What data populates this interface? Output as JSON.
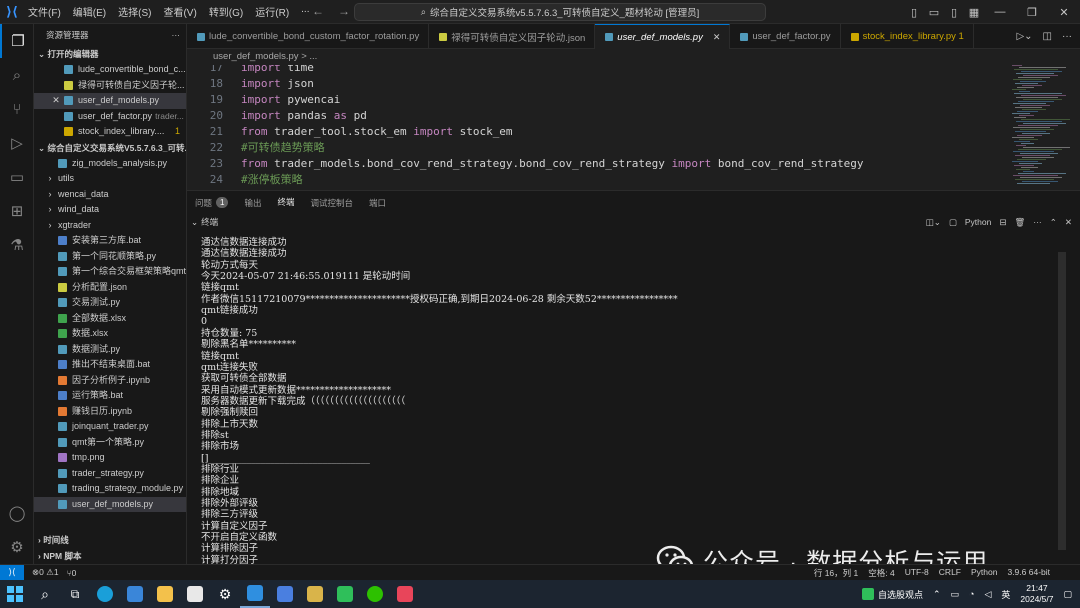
{
  "titlebar": {
    "menu": [
      "文件(F)",
      "编辑(E)",
      "选择(S)",
      "查看(V)",
      "转到(G)",
      "运行(R)",
      "..."
    ],
    "search": "综合自定义交易系统v5.5.7.6.3_可转债自定义_题材轮动 [管理员]"
  },
  "sidebar": {
    "title": "资源管理器",
    "open_editors_label": "打开的编辑器",
    "open_editors": [
      {
        "name": "lude_convertible_bond_c...",
        "extra": "",
        "color": "#519aba"
      },
      {
        "name": "禄得可转债自定义因子轮...",
        "extra": "",
        "color": "#cbcb41"
      },
      {
        "name": "user_def_models.py",
        "extra": "",
        "color": "#519aba"
      },
      {
        "name": "user_def_factor.py",
        "extra": "trader...",
        "color": "#519aba"
      },
      {
        "name": "stock_index_library....",
        "extra": "1",
        "color": "#cca700"
      }
    ],
    "workspace_label": "综合自定义交易系统V5.5.7.6.3_可转...",
    "files": [
      {
        "name": "zig_models_analysis.py",
        "kind": "py"
      },
      {
        "name": "utils",
        "kind": "folder"
      },
      {
        "name": "wencai_data",
        "kind": "folder"
      },
      {
        "name": "wind_data",
        "kind": "folder"
      },
      {
        "name": "xgtrader",
        "kind": "folder"
      },
      {
        "name": "安装第三方库.bat",
        "kind": "bat"
      },
      {
        "name": "第一个同花顺策略.py",
        "kind": "py"
      },
      {
        "name": "第一个综合交易框架策略qmt.py",
        "kind": "py"
      },
      {
        "name": "分析配置.json",
        "kind": "json"
      },
      {
        "name": "交易测试.py",
        "kind": "py"
      },
      {
        "name": "全部数据.xlsx",
        "kind": "xlsx"
      },
      {
        "name": "数据.xlsx",
        "kind": "xlsx"
      },
      {
        "name": "数据测试.py",
        "kind": "py"
      },
      {
        "name": "推出不结束桌面.bat",
        "kind": "bat"
      },
      {
        "name": "因子分析例子.ipynb",
        "kind": "ipynb"
      },
      {
        "name": "运行策略.bat",
        "kind": "bat"
      },
      {
        "name": "赚钱日历.ipynb",
        "kind": "ipynb"
      },
      {
        "name": "joinquant_trader.py",
        "kind": "py"
      },
      {
        "name": "qmt第一个策略.py",
        "kind": "py"
      },
      {
        "name": "tmp.png",
        "kind": "png"
      },
      {
        "name": "trader_strategy.py",
        "kind": "py"
      },
      {
        "name": "trading_strategy_module.py",
        "kind": "py"
      },
      {
        "name": "user_def_models.py",
        "kind": "py"
      }
    ],
    "timeline_label": "时间线",
    "npm_label": "NPM 脚本"
  },
  "tabs": [
    {
      "name": "lude_convertible_bond_custom_factor_rotation.py",
      "color": "#519aba",
      "state": ""
    },
    {
      "name": "禄得可转债自定义因子轮动.json",
      "color": "#cbcb41",
      "state": ""
    },
    {
      "name": "user_def_models.py",
      "color": "#519aba",
      "state": "active"
    },
    {
      "name": "user_def_factor.py",
      "color": "#519aba",
      "state": ""
    },
    {
      "name": "stock_index_library.py 1",
      "color": "#cca700",
      "state": "warn"
    }
  ],
  "breadcrumb": "user_def_models.py > ...",
  "code": [
    {
      "n": "17",
      "parts": [
        [
          "kw",
          "import"
        ],
        [
          "tx",
          " time"
        ]
      ]
    },
    {
      "n": "18",
      "parts": [
        [
          "kw",
          "import"
        ],
        [
          "tx",
          " json"
        ]
      ]
    },
    {
      "n": "19",
      "parts": [
        [
          "kw",
          "import"
        ],
        [
          "tx",
          " pywencai"
        ]
      ]
    },
    {
      "n": "20",
      "parts": [
        [
          "kw",
          "import"
        ],
        [
          "tx",
          " pandas "
        ],
        [
          "kw",
          "as"
        ],
        [
          "tx",
          " pd"
        ]
      ]
    },
    {
      "n": "21",
      "parts": [
        [
          "kw",
          "from"
        ],
        [
          "tx",
          " trader_tool.stock_em "
        ],
        [
          "kw",
          "import"
        ],
        [
          "tx",
          " stock_em"
        ]
      ]
    },
    {
      "n": "22",
      "parts": [
        [
          "cm",
          "#可转债趋势策略"
        ]
      ]
    },
    {
      "n": "23",
      "parts": [
        [
          "kw",
          "from"
        ],
        [
          "tx",
          " trader_models.bond_cov_rend_strategy.bond_cov_rend_strategy "
        ],
        [
          "kw",
          "import"
        ],
        [
          "tx",
          " bond_cov_rend_strategy"
        ]
      ]
    },
    {
      "n": "24",
      "parts": [
        [
          "cm",
          "#涨停板策略"
        ]
      ]
    }
  ],
  "panel": {
    "tabs": [
      "问题",
      "输出",
      "终端",
      "调试控制台",
      "端口"
    ],
    "problems_count": "1",
    "terminal_label": "终端",
    "python_label": "Python"
  },
  "terminal_lines": [
    "通达信数据连接成功",
    "通达信数据连接成功",
    "轮动方式每天",
    "今天2024-05-07 21:46:55.019111 是轮动时间",
    "链接qmt",
    "作者微信15117210079**********************授权码正确,到期日2024-06-28 剩余天数52*****************",
    "qmt链接成功",
    "0",
    "持仓数量: 75",
    "剔除黑名单**********",
    "链接qmt",
    "qmt连接失败",
    "获取可转债全部数据",
    "采用自动模式更新数据********************",
    "服务器数据更新下载完成（（（（（（（（（（（（（（（（（（（（",
    "剔除强制赎回",
    "排除上市天数",
    "排除st",
    "排除市场",
    "[]__________________________________",
    "排除行业",
    "排除企业",
    "排除地域",
    "排除外部评级",
    "排除三方评级",
    "计算自定义因子",
    "不开启自定义函数",
    "计算排除因子",
    "计算打分因子"
  ],
  "statusbar": {
    "errors": "⊗0 ⚠1",
    "ports": "⑂0",
    "position": "行 16，列 1",
    "spaces": "空格: 4",
    "encoding": "UTF-8",
    "eol": "CRLF",
    "language": "Python",
    "version": "3.9.6 64-bit"
  },
  "taskbar": {
    "stock_app": "自选股观点",
    "ime": "英",
    "time": "21:47",
    "date": "2024/5/7"
  },
  "watermark": "公众号 · 数据分析与运用"
}
